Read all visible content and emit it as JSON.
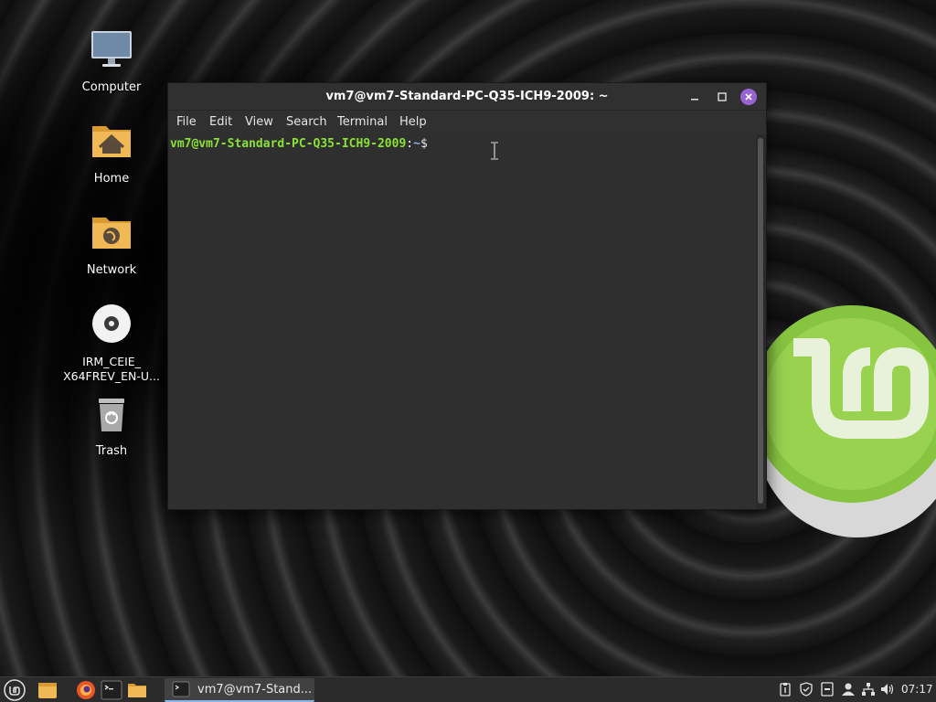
{
  "desktop": {
    "icons": [
      {
        "label": "Computer",
        "icon": "computer-icon"
      },
      {
        "label": "Home",
        "icon": "home-folder-icon"
      },
      {
        "label": "Network",
        "icon": "network-folder-icon"
      },
      {
        "label": "IRM_CEIE_ X64FREV_EN-U...",
        "icon": "optical-disc-icon"
      },
      {
        "label": "Trash",
        "icon": "trash-icon"
      }
    ]
  },
  "terminal": {
    "title": "vm7@vm7-Standard-PC-Q35-ICH9-2009: ~",
    "menu": [
      "File",
      "Edit",
      "View",
      "Search",
      "Terminal",
      "Help"
    ],
    "prompt": {
      "user_host": "vm7@vm7-Standard-PC-Q35-ICH9-2009",
      "separator": ":",
      "path": "~",
      "symbol": "$"
    }
  },
  "taskbar": {
    "launchers": [
      "mint-menu-icon",
      "show-desktop-icon",
      "firefox-icon",
      "terminal-icon",
      "files-icon"
    ],
    "window_button_label": "vm7@vm7-Stand...",
    "tray": [
      "clipboard-icon",
      "shield-icon",
      "update-manager-icon",
      "user-icon",
      "network-icon",
      "volume-icon"
    ],
    "clock": "07:17"
  },
  "colors": {
    "prompt_user": "#8ae234",
    "close_button": "#9a63d4",
    "mint_green": "#87c540",
    "folder": "#e9b04b"
  }
}
